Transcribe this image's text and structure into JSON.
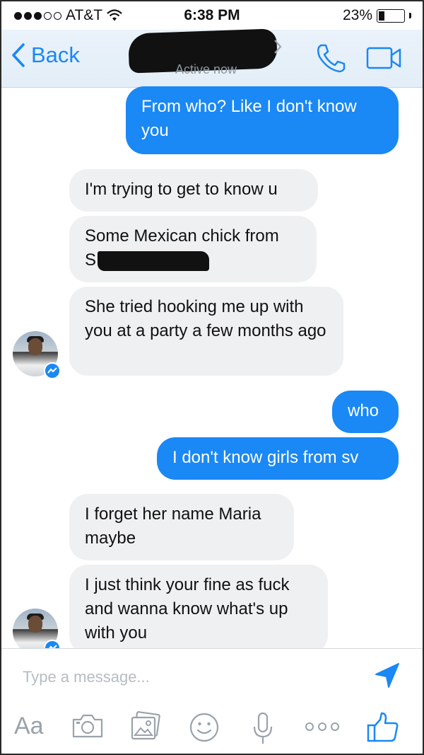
{
  "status_bar": {
    "carrier": "AT&T",
    "time": "6:38 PM",
    "battery": "23%",
    "battery_level": 0.23
  },
  "header": {
    "back_label": "Back",
    "presence": "Active now"
  },
  "messages": [
    {
      "from": "me",
      "text": "From who? Like I don't know you"
    },
    {
      "from": "them",
      "text": "I'm trying to get to know u"
    },
    {
      "from": "them",
      "text": "Some Mexican chick from",
      "text_line2": "S"
    },
    {
      "from": "them",
      "text": "She tried hooking me up with you at a party a few months ago"
    },
    {
      "from": "me",
      "text": "who"
    },
    {
      "from": "me",
      "text": "I don't know girls from sv"
    },
    {
      "from": "them",
      "text": "I forget her name Maria maybe"
    },
    {
      "from": "them",
      "text": "I just think your fine as fuck and wanna know what's up with you"
    }
  ],
  "composer": {
    "placeholder": "Type a message...",
    "aa_label": "Aa"
  },
  "icons": [
    "back-chevron-icon",
    "phone-icon",
    "video-camera-icon",
    "send-icon",
    "camera-icon",
    "gallery-icon",
    "emoji-icon",
    "microphone-icon",
    "more-icon",
    "like-icon",
    "messenger-badge-icon"
  ],
  "colors": {
    "accent": "#1a88f5",
    "incoming_bubble": "#eff0f2"
  }
}
